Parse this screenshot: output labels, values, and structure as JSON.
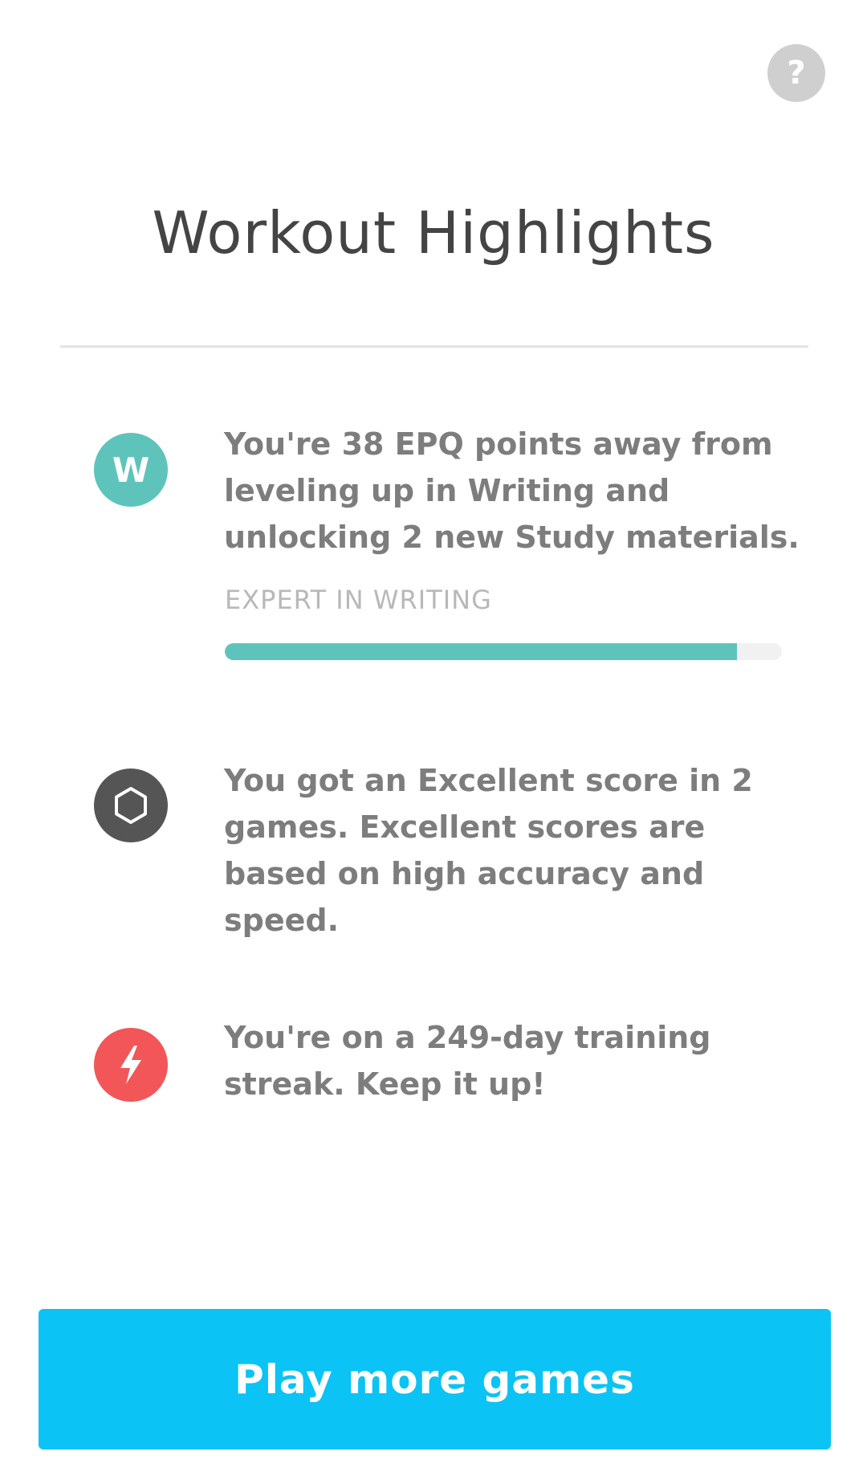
{
  "header": {
    "help_label": "?",
    "title": "Workout Highlights"
  },
  "highlights": [
    {
      "icon": "writing-badge-icon",
      "icon_letter": "W",
      "icon_color": "#5ec4bb",
      "text": "You're 38 EPQ points away from leveling up in Writing and unlocking 2 new Study materials.",
      "level_label": "EXPERT IN WRITING",
      "progress_fraction": 0.92
    },
    {
      "icon": "hexagon-icon",
      "icon_color": "#555555",
      "text": "You got an Excellent score in 2 games. Excellent scores are based on high accuracy and speed."
    },
    {
      "icon": "lightning-bolt-icon",
      "icon_color": "#f25658",
      "text": "You're on a 249-day training streak. Keep it up!"
    }
  ],
  "footer": {
    "play_label": "Play more games",
    "accent_color": "#0bc3f5"
  }
}
